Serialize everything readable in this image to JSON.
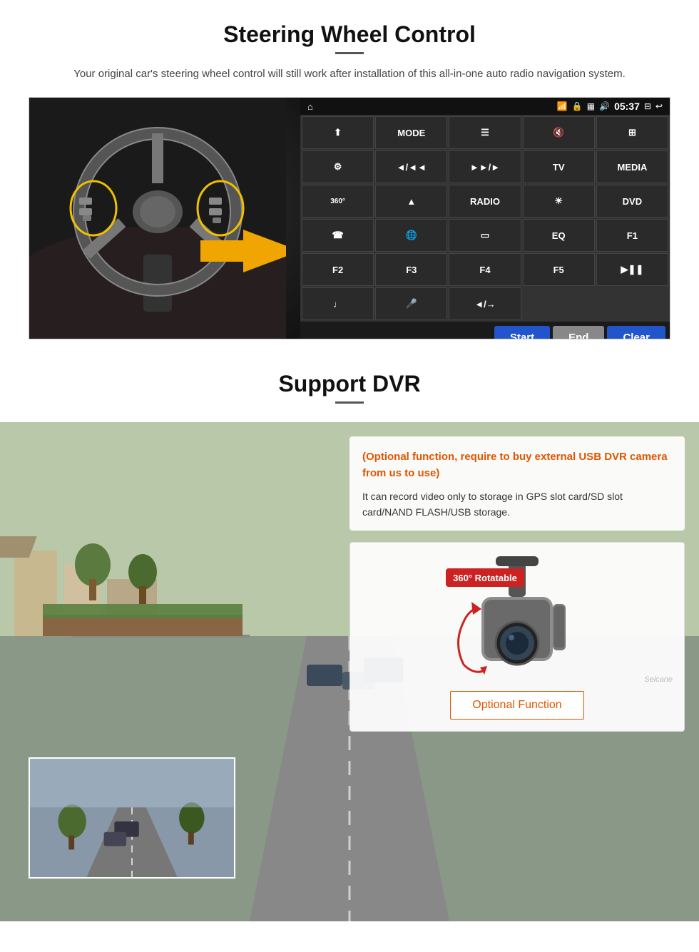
{
  "section1": {
    "title": "Steering Wheel Control",
    "description": "Your original car's steering wheel control will still work after installation of this all-in-one auto radio navigation system.",
    "statusBar": {
      "homeIcon": "⌂",
      "wifiIcon": "wifi",
      "lockIcon": "lock",
      "gridIcon": "grid",
      "soundIcon": "🔊",
      "time": "05:37",
      "windowIcon": "⊞",
      "backIcon": "↩"
    },
    "buttons": [
      {
        "id": "nav",
        "label": "⬆",
        "cols": 1
      },
      {
        "id": "mode",
        "label": "MODE",
        "cols": 1
      },
      {
        "id": "menu",
        "label": "☰",
        "cols": 1
      },
      {
        "id": "mute",
        "label": "🔇",
        "cols": 1
      },
      {
        "id": "apps",
        "label": "⊞",
        "cols": 1
      },
      {
        "id": "settings",
        "label": "⚙",
        "cols": 1
      },
      {
        "id": "prev",
        "label": "◄◄/◄",
        "cols": 1
      },
      {
        "id": "next",
        "label": "►►/►",
        "cols": 1
      },
      {
        "id": "tv",
        "label": "TV",
        "cols": 1
      },
      {
        "id": "media",
        "label": "MEDIA",
        "cols": 1
      },
      {
        "id": "cam360",
        "label": "360°",
        "cols": 1
      },
      {
        "id": "eject",
        "label": "▲",
        "cols": 1
      },
      {
        "id": "radio",
        "label": "RADIO",
        "cols": 1
      },
      {
        "id": "bright",
        "label": "☀",
        "cols": 1
      },
      {
        "id": "dvd",
        "label": "DVD",
        "cols": 1
      },
      {
        "id": "phone",
        "label": "📞",
        "cols": 1
      },
      {
        "id": "web",
        "label": "🌐",
        "cols": 1
      },
      {
        "id": "screen",
        "label": "▭",
        "cols": 1
      },
      {
        "id": "eq",
        "label": "EQ",
        "cols": 1
      },
      {
        "id": "f1",
        "label": "F1",
        "cols": 1
      },
      {
        "id": "f2",
        "label": "F2",
        "cols": 1
      },
      {
        "id": "f3",
        "label": "F3",
        "cols": 1
      },
      {
        "id": "f4",
        "label": "F4",
        "cols": 1
      },
      {
        "id": "f5",
        "label": "F5",
        "cols": 1
      },
      {
        "id": "playpause",
        "label": "▶❚❚",
        "cols": 1
      },
      {
        "id": "music",
        "label": "♩",
        "cols": 1
      },
      {
        "id": "mic",
        "label": "🎤",
        "cols": 1
      },
      {
        "id": "volmute",
        "label": "◄◄/→",
        "cols": 1
      }
    ],
    "actionBar": {
      "startLabel": "Start",
      "endLabel": "End",
      "clearLabel": "Clear"
    }
  },
  "section2": {
    "title": "Support DVR",
    "optionalText": "(Optional function, require to buy external USB DVR camera from us to use)",
    "descText": "It can record video only to storage in GPS slot card/SD slot card/NAND FLASH/USB storage.",
    "cameraLabel": "360° Rotatable",
    "optionalFunctionLabel": "Optional Function",
    "watermark": "Seicane"
  }
}
